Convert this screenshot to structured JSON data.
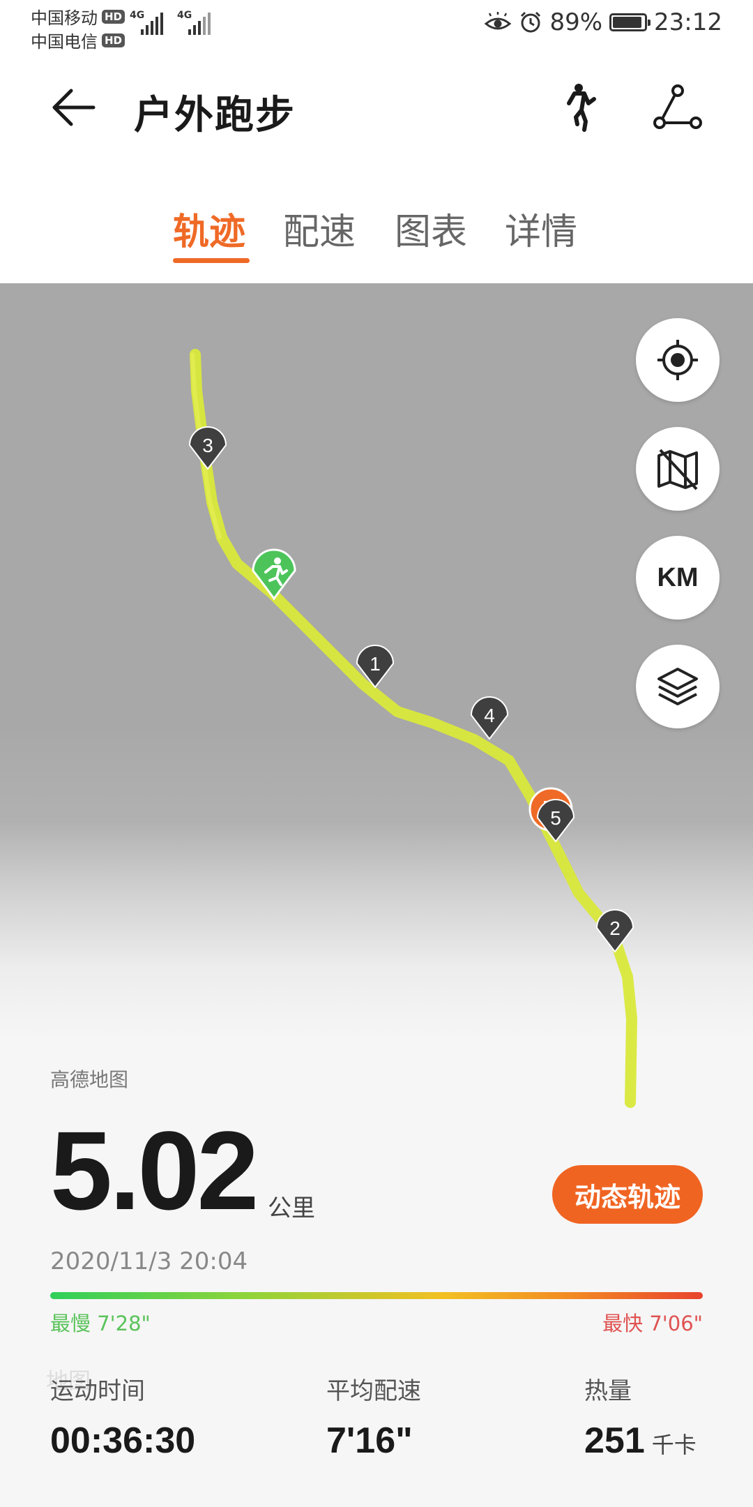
{
  "status_bar": {
    "carrier1": "中国移动",
    "carrier2": "中国电信",
    "hd": "HD",
    "net1": "4G",
    "net2": "4G",
    "battery": "89%",
    "time": "23:12"
  },
  "header": {
    "title": "户外跑步"
  },
  "tabs": [
    "轨迹",
    "配速",
    "图表",
    "详情"
  ],
  "active_tab": 0,
  "map": {
    "provider": "高德地图",
    "watermark": "地图",
    "km_button": "KM",
    "track_color": "#d9e83a",
    "markers": [
      "3",
      "1",
      "4",
      "5",
      "2"
    ]
  },
  "summary": {
    "distance": "5.02",
    "distance_unit": "公里",
    "replay_button": "动态轨迹",
    "datetime": "2020/11/3 20:04",
    "slowest": "最慢 7'28\"",
    "fastest": "最快 7'06\""
  },
  "stats": [
    {
      "label": "运动时间",
      "value": "00:36:30",
      "unit": ""
    },
    {
      "label": "平均配速",
      "value": "7'16\"",
      "unit": ""
    },
    {
      "label": "热量",
      "value": "251",
      "unit": "千卡"
    }
  ],
  "colors": {
    "accent": "#ef6a26",
    "start_marker": "#4cc45a",
    "slowest": "#5ac35a",
    "fastest": "#e05252"
  }
}
